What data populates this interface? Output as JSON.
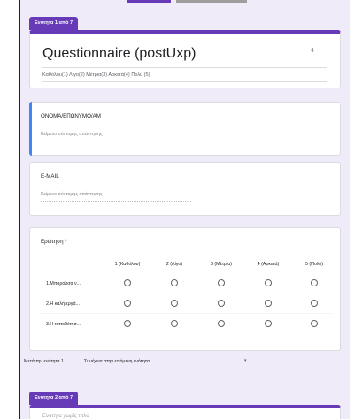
{
  "form": {
    "section_tab_1": "Ενότητα 1 από 7",
    "title": "Questionnaire (postUxp)",
    "description": "Καθόλου(1) Λίγο(2)  Μέτρια(3) Αρκετά(4)  Πολύ (5)"
  },
  "questions": {
    "name": {
      "title": "ΟΝΟΜΑ/ΕΠΩΝΥΜΟ/ΑΜ",
      "placeholder": "Κείμενο σύντομης απάντησης"
    },
    "email": {
      "title": "E-MAIL",
      "placeholder": "Κείμενο σύντομης απάντησης"
    },
    "grid": {
      "title": "Ερώτηση",
      "required_mark": "*",
      "columns": [
        "1 (Καθόλου)",
        "2 (Λίγο)",
        "3 (Μέτρια)",
        "4 (Αρκετά)",
        "5 (Πολύ)"
      ],
      "rows": [
        "1.Μπορούσα ν...",
        "2.Η καλή εργά...",
        "3.Η τοποθέτησ..."
      ]
    }
  },
  "after_section": {
    "label": "Μετά την ενότητα 1",
    "value": "Συνέχεια στην επόμενη ενότητα"
  },
  "section_tab_2": "Ενότητα 2 από 7",
  "next_section_title": "Ενότητα χωρίς τίτλο",
  "colors": {
    "accent": "#673ab7",
    "focus": "#4285f4",
    "background": "#f0ebf8"
  },
  "icons": {
    "collapse": "collapse-icon",
    "more": "more-vert-icon",
    "dropdown": "caret-down-icon"
  }
}
